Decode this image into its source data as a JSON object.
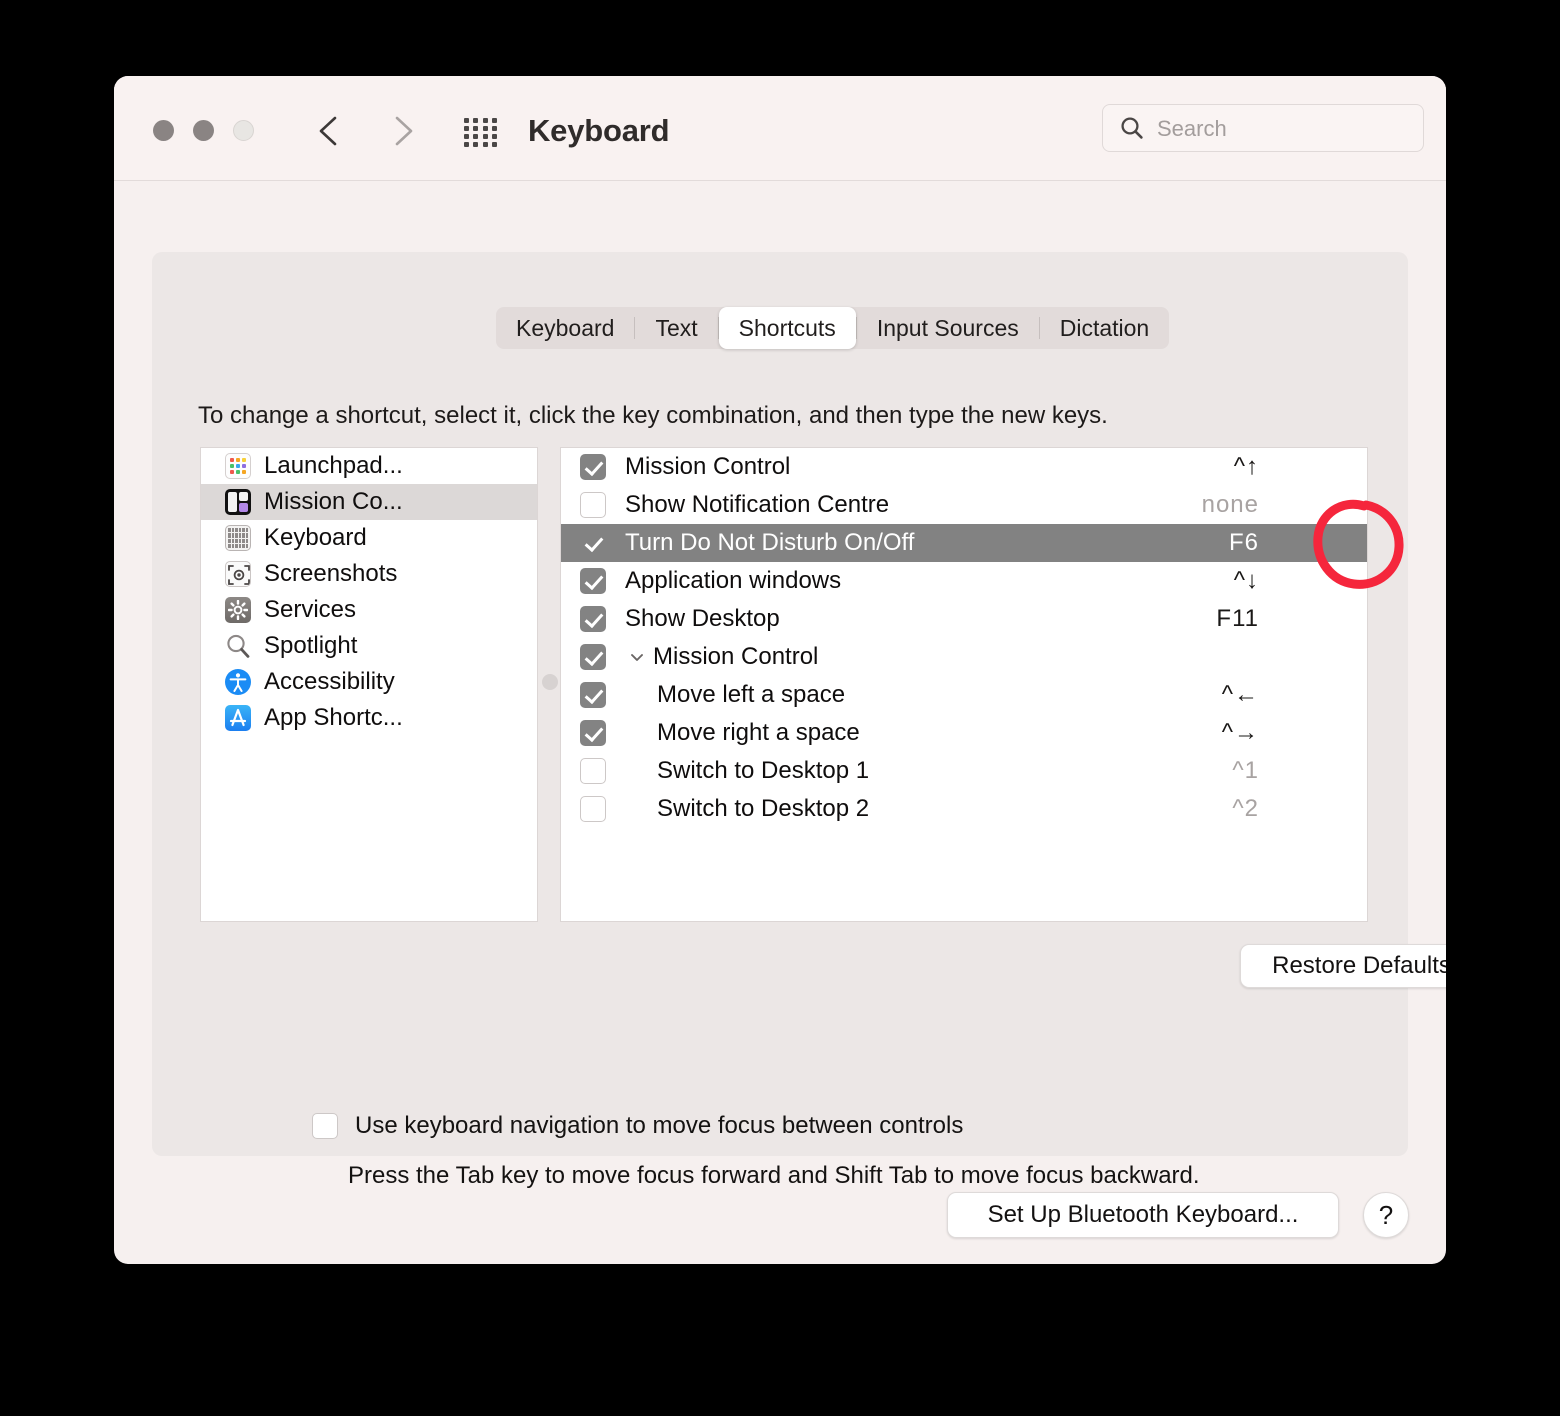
{
  "window": {
    "title": "Keyboard",
    "traffic_lights": [
      "close",
      "minimize",
      "zoom"
    ],
    "nav_back": "back-chevron",
    "nav_forward": "forward-chevron",
    "grid_icon": "show-all-grid-icon"
  },
  "search": {
    "placeholder": "Search",
    "value": "",
    "icon": "search-icon"
  },
  "tabs": [
    {
      "label": "Keyboard",
      "selected": false
    },
    {
      "label": "Text",
      "selected": false
    },
    {
      "label": "Shortcuts",
      "selected": true
    },
    {
      "label": "Input Sources",
      "selected": false
    },
    {
      "label": "Dictation",
      "selected": false
    }
  ],
  "instruction": "To change a shortcut, select it, click the key combination, and then type the new keys.",
  "sidebar": {
    "items": [
      {
        "label": "Launchpad...",
        "icon": "launchpad-icon",
        "selected": false
      },
      {
        "label": "Mission Co...",
        "icon": "mission-control-icon",
        "selected": true
      },
      {
        "label": "Keyboard",
        "icon": "keyboard-icon",
        "selected": false
      },
      {
        "label": "Screenshots",
        "icon": "screenshots-icon",
        "selected": false
      },
      {
        "label": "Services",
        "icon": "services-gear-icon",
        "selected": false
      },
      {
        "label": "Spotlight",
        "icon": "spotlight-magnifier-icon",
        "selected": false
      },
      {
        "label": "Accessibility",
        "icon": "accessibility-icon",
        "selected": false
      },
      {
        "label": "App Shortc...",
        "icon": "app-store-icon",
        "selected": false
      }
    ]
  },
  "shortcuts": {
    "rows": [
      {
        "label": "Mission Control",
        "key": "^↑",
        "checked": true,
        "selected": false,
        "child": false,
        "group": false,
        "dim": false
      },
      {
        "label": "Show Notification Centre",
        "key": "none",
        "checked": false,
        "selected": false,
        "child": false,
        "group": false,
        "dim": true
      },
      {
        "label": "Turn Do Not Disturb On/Off",
        "key": "F6",
        "checked": true,
        "selected": true,
        "child": false,
        "group": false,
        "dim": false
      },
      {
        "label": "Application windows",
        "key": "^↓",
        "checked": true,
        "selected": false,
        "child": false,
        "group": false,
        "dim": false
      },
      {
        "label": "Show Desktop",
        "key": "F11",
        "checked": true,
        "selected": false,
        "child": false,
        "group": false,
        "dim": false
      },
      {
        "label": "Mission Control",
        "key": "",
        "checked": true,
        "selected": false,
        "child": false,
        "group": true,
        "dim": false
      },
      {
        "label": "Move left a space",
        "key": "^←",
        "checked": true,
        "selected": false,
        "child": true,
        "group": false,
        "dim": false
      },
      {
        "label": "Move right a space",
        "key": "^→",
        "checked": true,
        "selected": false,
        "child": true,
        "group": false,
        "dim": false
      },
      {
        "label": "Switch to Desktop 1",
        "key": "^1",
        "checked": false,
        "selected": false,
        "child": true,
        "group": false,
        "dim": true
      },
      {
        "label": "Switch to Desktop 2",
        "key": "^2",
        "checked": false,
        "selected": false,
        "child": true,
        "group": false,
        "dim": true
      }
    ]
  },
  "buttons": {
    "restore_defaults": "Restore Defaults",
    "bluetooth_keyboard": "Set Up Bluetooth Keyboard...",
    "help": "?"
  },
  "keyboard_navigation": {
    "label": "Use keyboard navigation to move focus between controls",
    "checked": false,
    "sublabel": "Press the Tab key to move focus forward and Shift Tab to move focus backward."
  },
  "annotation": {
    "type": "hand-drawn-circle",
    "target": "F6",
    "color": "#f5263c"
  },
  "colors": {
    "window_bg": "#f6f0ef",
    "titlebar_bg": "#f9f2f1",
    "panel_bg": "#ece7e6",
    "list_bg": "#ffffff",
    "row_selected": "#828282",
    "sidebar_selected": "#dcd8d7",
    "accent_red": "#f5263c"
  }
}
